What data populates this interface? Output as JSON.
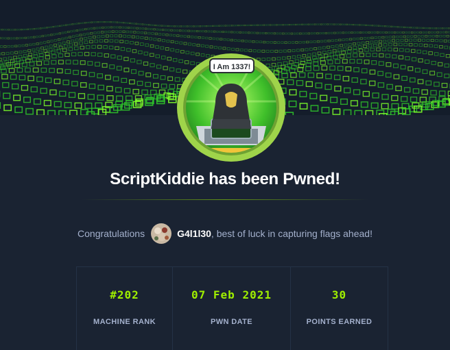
{
  "page": {
    "title": "ScriptKiddie has been Pwned!",
    "badge_text": "I Am 1337!",
    "congrats_prefix": "Congratulations",
    "username": "G4l1l30",
    "congrats_suffix": ", best of luck in capturing flags ahead!"
  },
  "stats": [
    {
      "value": "#202",
      "label": "MACHINE RANK"
    },
    {
      "value": "07 Feb 2021",
      "label": "PWN DATE"
    },
    {
      "value": "30",
      "label": "POINTS EARNED"
    }
  ],
  "colors": {
    "background": "#1a2332",
    "accent": "#9fef00",
    "muted_text": "#a4b1cd",
    "badge_ring": "#9fd44a"
  },
  "icons": {
    "banner": "green-cube-grid-wave",
    "badge": "hooded-hacker-icon",
    "avatar": "user-avatar"
  }
}
